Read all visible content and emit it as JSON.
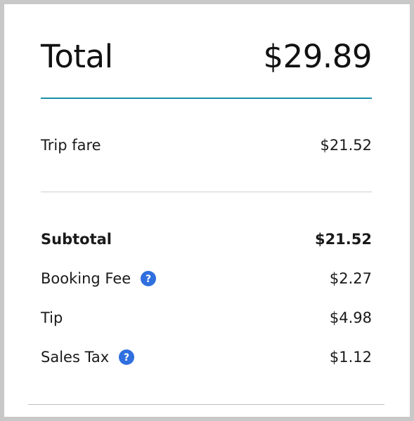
{
  "total": {
    "label": "Total",
    "value": "$29.89"
  },
  "trip_fare": {
    "label": "Trip fare",
    "value": "$21.52"
  },
  "subtotal": {
    "label": "Subtotal",
    "value": "$21.52"
  },
  "booking_fee": {
    "label": "Booking Fee",
    "value": "$2.27",
    "icon": "help-icon"
  },
  "tip": {
    "label": "Tip",
    "value": "$4.98"
  },
  "sales_tax": {
    "label": "Sales Tax",
    "value": "$1.12",
    "icon": "help-icon"
  },
  "colors": {
    "accent_rule": "#1a8fa6",
    "help_icon": "#2f6fde"
  }
}
